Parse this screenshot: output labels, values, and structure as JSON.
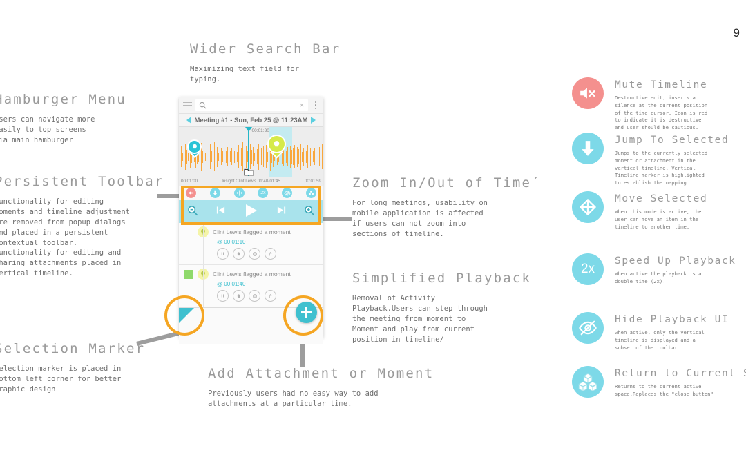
{
  "page": {
    "number": "9"
  },
  "colors": {
    "accent_orange": "#f5a623",
    "teal": "#7dd9e8",
    "red": "#f4908e",
    "wave_orange": "#f9a73c",
    "cursor": "#25b7c8"
  },
  "annotations": [
    {
      "id": "hamburger-menu",
      "title": "Hamburger Menu",
      "body": "Users can navigate more\neasily to top screens\nvia main hamburger"
    },
    {
      "id": "persistent-toolbar",
      "title": "Persistent Toolbar",
      "body": "Functionality for editing\nmoments and timeline adjustment\nare removed from popup dialogs\nand placed in a persistent\ncontextual toolbar.\nFunctionality for editing  and\nsharing attachments placed in\nvertical timeline."
    },
    {
      "id": "selection-marker",
      "title": "Selection Marker",
      "body": "Selection marker is placed in\nbottom left corner for better\ngraphic design"
    },
    {
      "id": "wider-search-bar",
      "title": "Wider Search Bar",
      "body": "Maximizing text field for\ntyping."
    },
    {
      "id": "zoom-in-out-of-time",
      "title": "Zoom In/Out of Time´",
      "body": "For long meetings, usability on\nmobile application is affected\nif users can not zoom into\nsections of timeline."
    },
    {
      "id": "simplified-playback",
      "title": "Simplified Playback",
      "body": "Removal of Activity\nPlayback.Users can step through\nthe meeting from moment to\nMoment and play from current\nposition in timeline/"
    },
    {
      "id": "add-attachment-or-moment",
      "title": "Add Attachment or Moment",
      "body": "Previously users had no easy way to add\nattachments at a particular time."
    }
  ],
  "phone": {
    "search": {
      "value": "",
      "placeholder": "",
      "clear_label": "×"
    },
    "meeting_title": "Meeting #1 - Sun, Feb 25 @ 11:23AM",
    "timeline": {
      "cursor_time": "00:01:30",
      "start_time": "00:01:00",
      "end_time": "00:01:59",
      "caption": "Insight Clint Lewis 01:40-01:45",
      "bars": [
        30,
        52,
        22,
        44,
        66,
        34,
        20,
        58,
        30,
        46,
        26,
        60,
        38,
        24,
        52,
        70,
        32,
        44,
        20,
        56,
        38,
        62,
        28,
        46,
        74,
        34,
        50,
        22,
        64,
        40,
        28,
        56,
        32,
        48,
        68,
        26,
        42,
        58,
        30,
        50,
        24,
        60,
        36,
        46,
        72,
        30,
        54,
        26,
        44,
        62,
        34,
        48,
        20,
        56,
        38,
        66,
        28,
        42,
        52,
        30,
        58,
        24,
        46,
        70,
        32,
        50,
        22,
        60,
        40,
        28,
        54,
        36,
        44,
        64,
        30,
        48,
        26,
        56,
        34,
        42,
        60,
        28,
        50,
        38,
        66,
        24,
        44,
        52,
        30,
        58,
        32,
        46,
        68,
        26,
        40,
        54,
        22,
        48,
        36,
        62
      ],
      "pins": [
        {
          "type": "insight-pin",
          "color": "#2cc4d6"
        },
        {
          "type": "insight-pin",
          "color": "#d6ea4a"
        }
      ]
    },
    "toolbar": {
      "icons": [
        {
          "name": "mute-timeline-icon",
          "color": "#f4908e",
          "glyph": "mute"
        },
        {
          "name": "jump-to-selected-icon",
          "color": "#7dd9e8",
          "glyph": "arrow-down"
        },
        {
          "name": "move-selected-icon",
          "color": "#7dd9e8",
          "glyph": "move"
        },
        {
          "name": "speed-up-playback-icon",
          "color": "#7dd9e8",
          "glyph": "2x"
        },
        {
          "name": "hide-playback-ui-icon",
          "color": "#7dd9e8",
          "glyph": "eye-off"
        },
        {
          "name": "return-to-current-space-icon",
          "color": "#7dd9e8",
          "glyph": "cubes"
        }
      ],
      "controls": [
        {
          "name": "zoom-out-button",
          "glyph": "magnifier-minus"
        },
        {
          "name": "previous-moment-button",
          "glyph": "skip-back"
        },
        {
          "name": "play-button",
          "glyph": "play"
        },
        {
          "name": "next-moment-button",
          "glyph": "skip-forward"
        },
        {
          "name": "zoom-in-button",
          "glyph": "magnifier-plus"
        }
      ]
    },
    "activity": [
      {
        "user": "Clint Lewis",
        "action": "flagged a moment",
        "time": "@ 00:01:10",
        "buttons": [
          "pause-icon",
          "trash-icon",
          "gear-icon",
          "share-icon"
        ]
      },
      {
        "user": "Clint Lewis",
        "action": "flagged a moment",
        "time": "@ 00:01:40",
        "buttons": [
          "pause-icon",
          "trash-icon",
          "gear-icon",
          "share-icon"
        ]
      }
    ],
    "fab_label": "+"
  },
  "features": [
    {
      "id": "mute-timeline",
      "title": "Mute Timeline",
      "desc": "Destructive edit, inserts a\nsilence at the current position\nof the time cursor. Icon is red\nto indicate it is destructive\nand user should be cautious.",
      "color": "#f4908e",
      "icon": "mute-icon"
    },
    {
      "id": "jump-to-selected",
      "title": "Jump To Selected",
      "desc": "Jumps to the currently selected\nmoment or attachment in the\nvertical timeline. Vertical\nTimeline marker is highlighted\nto establish the mapping.",
      "color": "#7dd9e8",
      "icon": "arrow-down-icon"
    },
    {
      "id": "move-selected",
      "title": "Move Selected",
      "desc": "When this mode is active, the\nuser can move an item in the\ntimeline to another time.",
      "color": "#7dd9e8",
      "icon": "move-icon"
    },
    {
      "id": "speed-up-playback",
      "title": "Speed Up Playback",
      "desc": "When active the playback is a\ndouble time (2x).",
      "color": "#7dd9e8",
      "icon": "2x-icon",
      "icon_text": "2x"
    },
    {
      "id": "hide-playback-ui",
      "title": "Hide Playback UI",
      "desc": "when active, only the vertical\ntimeline is displayed and a\nsubset of the toolbar.",
      "color": "#7dd9e8",
      "icon": "eye-off-icon"
    },
    {
      "id": "return-to-current-space",
      "title": "Return to Current Space",
      "desc": "Returns to the current active\nspace.Replaces the \"close button\"",
      "color": "#7dd9e8",
      "icon": "cubes-icon"
    }
  ]
}
